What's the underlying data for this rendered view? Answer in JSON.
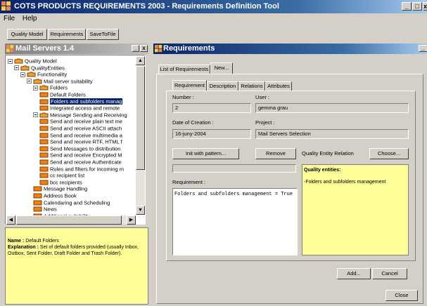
{
  "window": {
    "title": "COTS PRODUCTS REQUIREMENTS 2003 - Requirements Definition Tool",
    "min": "_",
    "max": "□",
    "close": "x"
  },
  "menu": [
    "File",
    "Help"
  ],
  "toolbar": {
    "quality_model": "Quality Model",
    "requirements": "Requirements",
    "save": "SaveToFile"
  },
  "left_panel": {
    "title": "Mail Servers 1.4",
    "min": "_",
    "close": "x",
    "tree": [
      {
        "label": "Quality Model",
        "level": 0,
        "kind": "root",
        "expanded": true
      },
      {
        "label": "QualityEntities",
        "level": 1,
        "kind": "folder",
        "expanded": true
      },
      {
        "label": "Functionality",
        "level": 2,
        "kind": "folder",
        "expanded": true
      },
      {
        "label": "Mail server suitability",
        "level": 3,
        "kind": "folder",
        "expanded": true
      },
      {
        "label": "Folders",
        "level": 4,
        "kind": "folder",
        "expanded": true
      },
      {
        "label": "Default Folders",
        "level": 5,
        "kind": "leaf"
      },
      {
        "label": "Folders and subfolders manag",
        "level": 5,
        "kind": "leaf",
        "selected": true
      },
      {
        "label": "Integrated access and remote",
        "level": 5,
        "kind": "leaf"
      },
      {
        "label": "Message Sending and Receiving",
        "level": 4,
        "kind": "folder",
        "expanded": true
      },
      {
        "label": "Send and receive plain text me",
        "level": 5,
        "kind": "leaf"
      },
      {
        "label": "Send and receive ASCII attach",
        "level": 5,
        "kind": "leaf"
      },
      {
        "label": "Send and receive multimedia a",
        "level": 5,
        "kind": "leaf"
      },
      {
        "label": "Send and receive RTF, HTML f",
        "level": 5,
        "kind": "leaf"
      },
      {
        "label": "Send Messages to distribution",
        "level": 5,
        "kind": "leaf"
      },
      {
        "label": "Send and receive Encrypted M",
        "level": 5,
        "kind": "leaf"
      },
      {
        "label": "Send and receive Authenticate",
        "level": 5,
        "kind": "leaf"
      },
      {
        "label": "Rules and filters for incoming m",
        "level": 5,
        "kind": "leaf"
      },
      {
        "label": "cc recipient list",
        "level": 5,
        "kind": "leaf"
      },
      {
        "label": "bcc recipients",
        "level": 5,
        "kind": "leaf"
      },
      {
        "label": "Message Handling",
        "level": 4,
        "kind": "leaf"
      },
      {
        "label": "Address Book",
        "level": 4,
        "kind": "leaf"
      },
      {
        "label": "Calendaring and Scheduling",
        "level": 4,
        "kind": "leaf"
      },
      {
        "label": "News",
        "level": 4,
        "kind": "leaf"
      },
      {
        "label": "Additional suitability",
        "level": 4,
        "kind": "leaf"
      }
    ],
    "info": {
      "name_label": "Name :",
      "name_value": "Default Folders",
      "explanation_label": "Explanation :",
      "explanation_value": "Set of default folders provided (usually Inbox, Outbox, Sent Folder, Draft Folder and Trash Folder)."
    }
  },
  "right_panel": {
    "title": "Requirements",
    "outer_tabs": [
      "List of Requirements",
      "New..."
    ],
    "inner_tabs": [
      "Requirement",
      "Description",
      "Relations",
      "Attributes"
    ],
    "number_label": "Number :",
    "number_value": "2",
    "user_label": "User :",
    "user_value": "gemma grau",
    "date_label": "Date of Creation :",
    "date_value": "16-juny-2004",
    "project_label": "Project :",
    "project_value": "Mail Servers Selection",
    "init_button": "Init with pattern...",
    "remove_button": "Remove",
    "relation_label": "Quality Entity Relation",
    "choose_button": "Choose...",
    "requirement_label": "Requirement :",
    "requirement_text": "Folders and subfolders management = True",
    "qe_title": "Quality entities:",
    "qe_item": "-Folders and subfolders management",
    "add_button": "Add...",
    "cancel_button": "Cancel",
    "close_button": "Close"
  },
  "colors": {
    "active_title": "#0a246a",
    "inactive_title": "#808080",
    "selected": "#0a246a",
    "yellow": "#ffff99",
    "face": "#d4d0c8"
  }
}
